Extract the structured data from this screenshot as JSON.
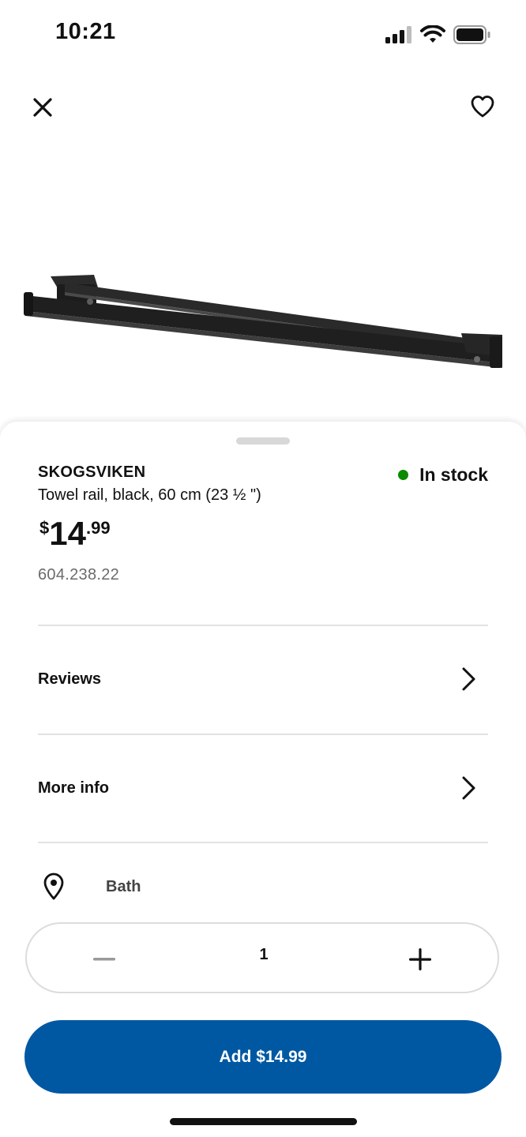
{
  "status_bar": {
    "time": "10:21"
  },
  "product": {
    "name": "SKOGSVIKEN",
    "description": "Towel rail, black, 60 cm (23 ½ \")",
    "price": {
      "currency": "$",
      "integer": "14",
      "decimals": ".99"
    },
    "stock_status": "In stock",
    "stock_color": "#0a8a00",
    "article_number": "604.238.22"
  },
  "rows": [
    {
      "label": "Reviews",
      "icon": "chevron-right-icon"
    },
    {
      "label": "More info",
      "icon": "chevron-right-icon"
    }
  ],
  "location": {
    "label": "Bath",
    "icon": "location-pin-icon"
  },
  "quantity": {
    "value": "1"
  },
  "add_button": {
    "label": "Add $14.99",
    "color": "#0058a3"
  }
}
